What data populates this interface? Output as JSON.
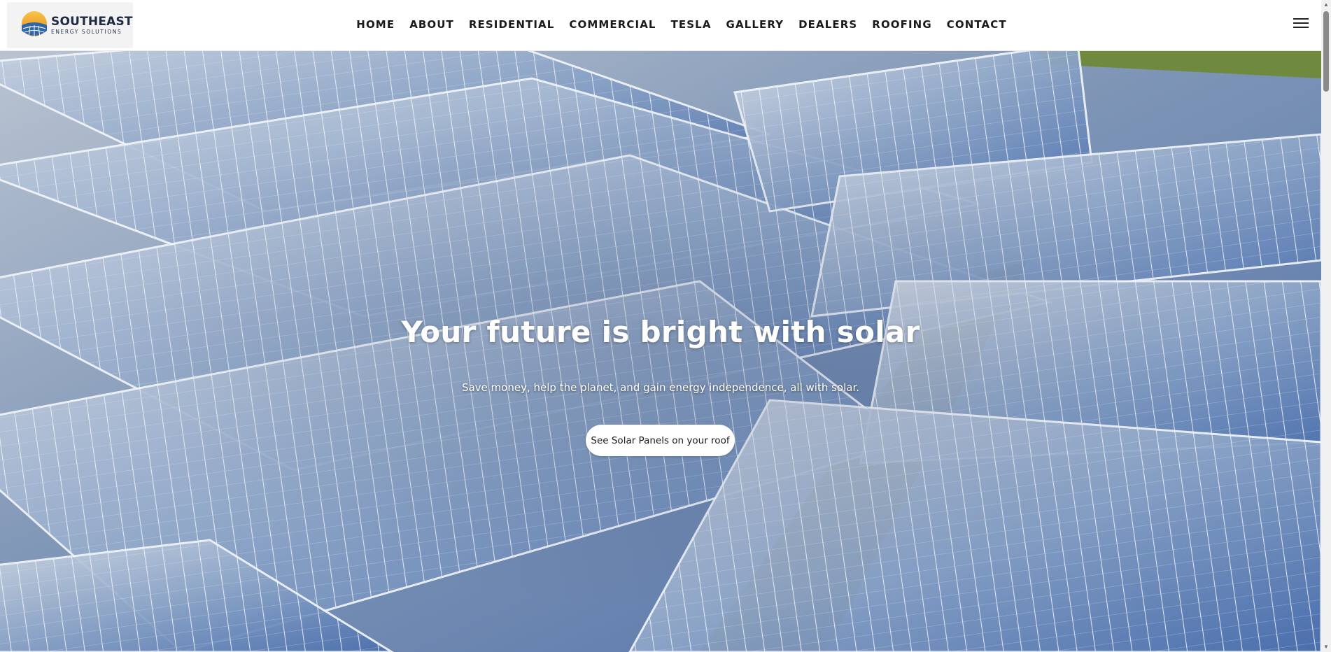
{
  "brand": {
    "name": "SOUTHEAST",
    "tagline": "ENERGY SOLUTIONS"
  },
  "nav": {
    "items": [
      {
        "label": "HOME"
      },
      {
        "label": "ABOUT"
      },
      {
        "label": "RESIDENTIAL"
      },
      {
        "label": "COMMERCIAL"
      },
      {
        "label": "TESLA"
      },
      {
        "label": "GALLERY"
      },
      {
        "label": "DEALERS"
      },
      {
        "label": "ROOFING"
      },
      {
        "label": "CONTACT"
      }
    ],
    "menu_icon": "hamburger-menu-icon"
  },
  "hero": {
    "title": "Your future is bright with solar",
    "subtitle": "Save money, help the planet, and gain energy independence, all with solar.",
    "cta_label": "See Solar Panels on your roof",
    "background": "aerial-solar-panel-field"
  },
  "colors": {
    "panel_blue": "#5d7fb5",
    "panel_light": "#c9d3e2",
    "ground": "#5b5a3a",
    "grass": "#6f8a3f",
    "brand_navy": "#1f2a44",
    "brand_orange": "#f3a21b"
  }
}
